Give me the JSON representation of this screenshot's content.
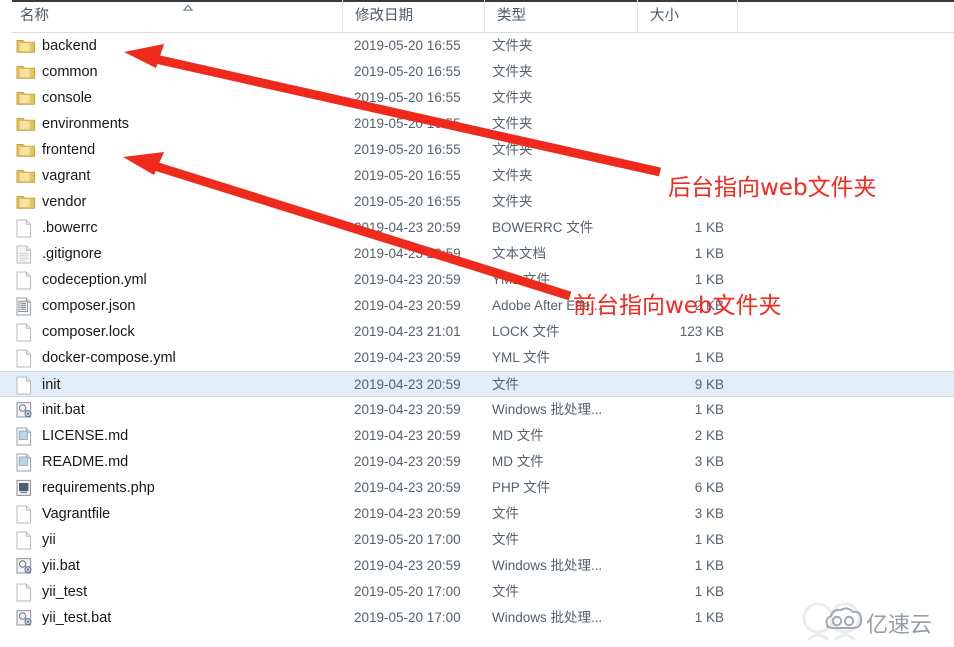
{
  "columns": [
    {
      "key": "name",
      "label": "名称"
    },
    {
      "key": "date",
      "label": "修改日期"
    },
    {
      "key": "type",
      "label": "类型"
    },
    {
      "key": "size",
      "label": "大小"
    }
  ],
  "sort": {
    "column": "名称",
    "direction": "ascending",
    "icon": "sort-ascending-icon"
  },
  "rows": [
    {
      "name": "backend",
      "date": "2019-05-20 16:55",
      "type": "文件夹",
      "size": "",
      "icon": "folder-icon",
      "selected": false
    },
    {
      "name": "common",
      "date": "2019-05-20 16:55",
      "type": "文件夹",
      "size": "",
      "icon": "folder-icon",
      "selected": false
    },
    {
      "name": "console",
      "date": "2019-05-20 16:55",
      "type": "文件夹",
      "size": "",
      "icon": "folder-icon",
      "selected": false
    },
    {
      "name": "environments",
      "date": "2019-05-20 16:55",
      "type": "文件夹",
      "size": "",
      "icon": "folder-icon",
      "selected": false
    },
    {
      "name": "frontend",
      "date": "2019-05-20 16:55",
      "type": "文件夹",
      "size": "",
      "icon": "folder-icon",
      "selected": false
    },
    {
      "name": "vagrant",
      "date": "2019-05-20 16:55",
      "type": "文件夹",
      "size": "",
      "icon": "folder-icon",
      "selected": false
    },
    {
      "name": "vendor",
      "date": "2019-05-20 16:55",
      "type": "文件夹",
      "size": "",
      "icon": "folder-icon",
      "selected": false
    },
    {
      "name": ".bowerrc",
      "date": "2019-04-23 20:59",
      "type": "BOWERRC 文件",
      "size": "1 KB",
      "icon": "blank-file-icon",
      "selected": false
    },
    {
      "name": ".gitignore",
      "date": "2019-04-23 20:59",
      "type": "文本文档",
      "size": "1 KB",
      "icon": "text-file-icon",
      "selected": false
    },
    {
      "name": "codeception.yml",
      "date": "2019-04-23 20:59",
      "type": "YML 文件",
      "size": "1 KB",
      "icon": "blank-file-icon",
      "selected": false
    },
    {
      "name": "composer.json",
      "date": "2019-04-23 20:59",
      "type": "Adobe After Effe...",
      "size": "2 KB",
      "icon": "json-file-icon",
      "selected": false
    },
    {
      "name": "composer.lock",
      "date": "2019-04-23 21:01",
      "type": "LOCK 文件",
      "size": "123 KB",
      "icon": "blank-file-icon",
      "selected": false
    },
    {
      "name": "docker-compose.yml",
      "date": "2019-04-23 20:59",
      "type": "YML 文件",
      "size": "1 KB",
      "icon": "blank-file-icon",
      "selected": false
    },
    {
      "name": "init",
      "date": "2019-04-23 20:59",
      "type": "文件",
      "size": "9 KB",
      "icon": "blank-file-icon",
      "selected": true
    },
    {
      "name": "init.bat",
      "date": "2019-04-23 20:59",
      "type": "Windows 批处理...",
      "size": "1 KB",
      "icon": "bat-file-icon",
      "selected": false
    },
    {
      "name": "LICENSE.md",
      "date": "2019-04-23 20:59",
      "type": "MD 文件",
      "size": "2 KB",
      "icon": "md-file-icon",
      "selected": false
    },
    {
      "name": "README.md",
      "date": "2019-04-23 20:59",
      "type": "MD 文件",
      "size": "3 KB",
      "icon": "md-file-icon",
      "selected": false
    },
    {
      "name": "requirements.php",
      "date": "2019-04-23 20:59",
      "type": "PHP 文件",
      "size": "6 KB",
      "icon": "php-file-icon",
      "selected": false
    },
    {
      "name": "Vagrantfile",
      "date": "2019-04-23 20:59",
      "type": "文件",
      "size": "3 KB",
      "icon": "blank-file-icon",
      "selected": false
    },
    {
      "name": "yii",
      "date": "2019-05-20 17:00",
      "type": "文件",
      "size": "1 KB",
      "icon": "blank-file-icon",
      "selected": false
    },
    {
      "name": "yii.bat",
      "date": "2019-04-23 20:59",
      "type": "Windows 批处理...",
      "size": "1 KB",
      "icon": "bat-file-icon",
      "selected": false
    },
    {
      "name": "yii_test",
      "date": "2019-05-20 17:00",
      "type": "文件",
      "size": "1 KB",
      "icon": "blank-file-icon",
      "selected": false
    },
    {
      "name": "yii_test.bat",
      "date": "2019-05-20 17:00",
      "type": "Windows 批处理...",
      "size": "1 KB",
      "icon": "bat-file-icon",
      "selected": false
    }
  ],
  "annotations": {
    "color": "#f22a20",
    "items": [
      {
        "id": "backend",
        "text": "后台指向web文件夹",
        "target": "backend"
      },
      {
        "id": "frontend",
        "text": "前台指向web文件夹",
        "target": "frontend"
      }
    ]
  },
  "watermark": {
    "text": "亿速云",
    "icon": "cloud-logo-icon"
  }
}
